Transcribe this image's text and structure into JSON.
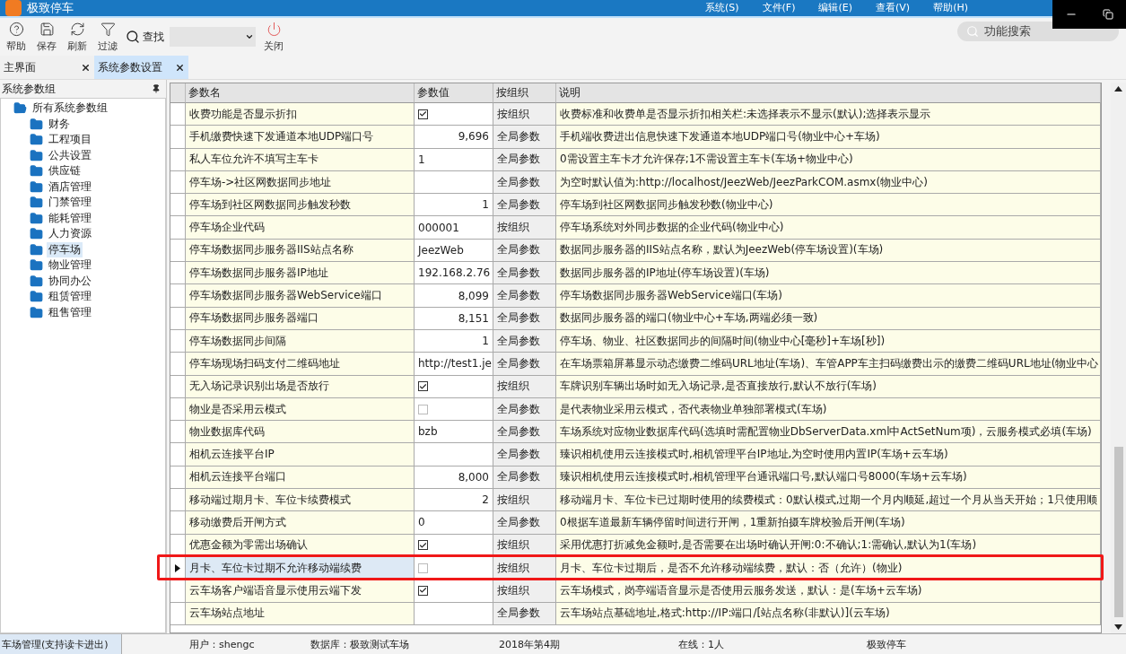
{
  "app": {
    "title": "极致停车",
    "menu": [
      "系统(S)",
      "文件(F)",
      "编辑(E)",
      "查看(V)",
      "帮助(H)"
    ]
  },
  "toolbar": {
    "buttons": [
      {
        "kind": "help",
        "label": "帮助"
      },
      {
        "kind": "save",
        "label": "保存"
      },
      {
        "kind": "refresh",
        "label": "刷新"
      },
      {
        "kind": "filter",
        "label": "过滤"
      }
    ],
    "find_label": "查找",
    "close_label": "关闭",
    "search_placeholder": "功能搜索"
  },
  "tabs": [
    {
      "label": "主界面",
      "selected": false
    },
    {
      "label": "系统参数设置",
      "selected": true
    }
  ],
  "sidebar": {
    "title": "系统参数组",
    "tree": [
      {
        "label": "所有系统参数组",
        "expanded": true,
        "selected": false,
        "children": [
          {
            "label": "财务",
            "expanded": false,
            "selected": false
          },
          {
            "label": "工程项目",
            "expanded": false,
            "selected": false
          },
          {
            "label": "公共设置",
            "expanded": false,
            "selected": false
          },
          {
            "label": "供应链",
            "expanded": false,
            "selected": false
          },
          {
            "label": "酒店管理",
            "expanded": false,
            "selected": false
          },
          {
            "label": "门禁管理",
            "expanded": false,
            "selected": false
          },
          {
            "label": "能耗管理",
            "expanded": false,
            "selected": false
          },
          {
            "label": "人力资源",
            "expanded": false,
            "selected": false
          },
          {
            "label": "停车场",
            "expanded": false,
            "selected": true
          },
          {
            "label": "物业管理",
            "expanded": false,
            "selected": false
          },
          {
            "label": "协同办公",
            "expanded": false,
            "selected": false
          },
          {
            "label": "租赁管理",
            "expanded": false,
            "selected": false
          },
          {
            "label": "租售管理",
            "expanded": false,
            "selected": false
          }
        ]
      }
    ]
  },
  "table": {
    "columns": [
      "参数名",
      "参数值",
      "按组织",
      "说明"
    ],
    "rows": [
      {
        "name": "收费功能是否显示折扣",
        "kind": "checkbox",
        "checked": true,
        "scope": "按组织",
        "description": "收费标准和收费单是否显示折扣相关栏:未选择表示不显示(默认);选择表示显示",
        "selected": false,
        "outlined": false
      },
      {
        "name": "手机缴费快速下发通道本地UDP端口号",
        "kind": "number",
        "value": "9,696",
        "scope": "全局参数",
        "description": "手机端收费进出信息快速下发通道本地UDP端口号(物业中心+车场)",
        "selected": false,
        "outlined": false
      },
      {
        "name": "私人车位允许不填写主车卡",
        "kind": "text",
        "value": "1",
        "scope": "全局参数",
        "description": "0需设置主车卡才允许保存;1不需设置主车卡(车场+物业中心)",
        "selected": false,
        "outlined": false
      },
      {
        "name": "停车场->社区网数据同步地址",
        "kind": "text",
        "value": "",
        "scope": "全局参数",
        "description": "为空时默认值为:http://localhost/JeezWeb/JeezParkCOM.asmx(物业中心)",
        "selected": false,
        "outlined": false
      },
      {
        "name": "停车场到社区网数据同步触发秒数",
        "kind": "number",
        "value": "1",
        "scope": "全局参数",
        "description": "停车场到社区网数据同步触发秒数(物业中心)",
        "selected": false,
        "outlined": false
      },
      {
        "name": "停车场企业代码",
        "kind": "text",
        "value": "000001",
        "scope": "按组织",
        "description": "停车场系统对外同步数据的企业代码(物业中心)",
        "selected": false,
        "outlined": false
      },
      {
        "name": "停车场数据同步服务器IIS站点名称",
        "kind": "text",
        "value": "JeezWeb",
        "scope": "全局参数",
        "description": "数据同步服务器的IIS站点名称，默认为JeezWeb(停车场设置)(车场)",
        "selected": false,
        "outlined": false
      },
      {
        "name": "停车场数据同步服务器IP地址",
        "kind": "text",
        "value": "192.168.2.76",
        "scope": "全局参数",
        "description": "数据同步服务器的IP地址(停车场设置)(车场)",
        "selected": false,
        "outlined": false
      },
      {
        "name": "停车场数据同步服务器WebService端口",
        "kind": "number",
        "value": "8,099",
        "scope": "全局参数",
        "description": "停车场数据同步服务器WebService端口(车场)",
        "selected": false,
        "outlined": false
      },
      {
        "name": "停车场数据同步服务器端口",
        "kind": "number",
        "value": "8,151",
        "scope": "全局参数",
        "description": "数据同步服务器的端口(物业中心+车场,两端必须一致)",
        "selected": false,
        "outlined": false
      },
      {
        "name": "停车场数据同步间隔",
        "kind": "number",
        "value": "1",
        "scope": "全局参数",
        "description": "停车场、物业、社区数据同步的间隔时间(物业中心[毫秒]+车场[秒])",
        "selected": false,
        "outlined": false
      },
      {
        "name": "停车场现场扫码支付二维码地址",
        "kind": "text",
        "value": "http://test1.je",
        "scope": "全局参数",
        "description": "在车场票箱屏幕显示动态缴费二维码URL地址(车场)、车管APP车主扫码缴费出示的缴费二维码URL地址(物业中心",
        "selected": false,
        "outlined": false
      },
      {
        "name": "无入场记录识别出场是否放行",
        "kind": "checkbox",
        "checked": true,
        "scope": "按组织",
        "description": "车牌识别车辆出场时如无入场记录,是否直接放行,默认不放行(车场)",
        "selected": false,
        "outlined": false
      },
      {
        "name": "物业是否采用云模式",
        "kind": "checkbox",
        "checked": false,
        "scope": "全局参数",
        "description": "是代表物业采用云模式，否代表物业单独部署模式(车场)",
        "selected": false,
        "outlined": false
      },
      {
        "name": "物业数据库代码",
        "kind": "text",
        "value": "bzb",
        "scope": "全局参数",
        "description": "车场系统对应物业数据库代码(选填时需配置物业DbServerData.xml中ActSetNum项)，云服务模式必填(车场)",
        "selected": false,
        "outlined": false
      },
      {
        "name": "相机云连接平台IP",
        "kind": "text",
        "value": "",
        "scope": "全局参数",
        "description": "臻识相机使用云连接模式时,相机管理平台IP地址,为空时使用内置IP(车场+云车场)",
        "selected": false,
        "outlined": false
      },
      {
        "name": "相机云连接平台端口",
        "kind": "number",
        "value": "8,000",
        "scope": "全局参数",
        "description": "臻识相机使用云连接模式时,相机管理平台通讯端口号,默认端口号8000(车场+云车场)",
        "selected": false,
        "outlined": false
      },
      {
        "name": "移动端过期月卡、车位卡续费模式",
        "kind": "number",
        "value": "2",
        "scope": "按组织",
        "description": "移动端月卡、车位卡已过期时使用的续费模式：0默认模式,过期一个月内顺延,超过一个月从当天开始；1只使用顺",
        "selected": false,
        "outlined": false
      },
      {
        "name": "移动缴费后开闸方式",
        "kind": "text",
        "value": "0",
        "scope": "全局参数",
        "description": "0根据车道最新车辆停留时间进行开闸，1重新拍摄车牌校验后开闸(车场)",
        "selected": false,
        "outlined": false
      },
      {
        "name": "优惠金额为零需出场确认",
        "kind": "checkbox",
        "checked": true,
        "scope": "按组织",
        "description": "采用优惠打折减免金额时,是否需要在出场时确认开闸:0:不确认;1:需确认,默认为1(车场)",
        "selected": false,
        "outlined": false
      },
      {
        "name": "月卡、车位卡过期不允许移动端续费",
        "kind": "checkbox",
        "checked": false,
        "scope": "按组织",
        "description": "月卡、车位卡过期后，是否不允许移动端续费，默认：否（允许）(物业)",
        "selected": true,
        "outlined": true
      },
      {
        "name": "云车场客户端语音显示使用云端下发",
        "kind": "checkbox",
        "checked": true,
        "scope": "按组织",
        "description": "云车场模式，岗亭端语音显示是否使用云服务发送，默认：是(车场+云车场)",
        "selected": false,
        "outlined": false
      },
      {
        "name": "云车场站点地址",
        "kind": "text",
        "value": "",
        "scope": "全局参数",
        "description": "云车场站点基础地址,格式:http://IP:端口/[站点名称(非默认)](云车场)",
        "selected": false,
        "outlined": false
      }
    ]
  },
  "status_bar": {
    "module": "车场管理(支持读卡进出)",
    "items": [
      "用户：shengc",
      "数据库：极致测试车场",
      "2018年第4期",
      "在线：1人",
      "极致停车"
    ]
  }
}
